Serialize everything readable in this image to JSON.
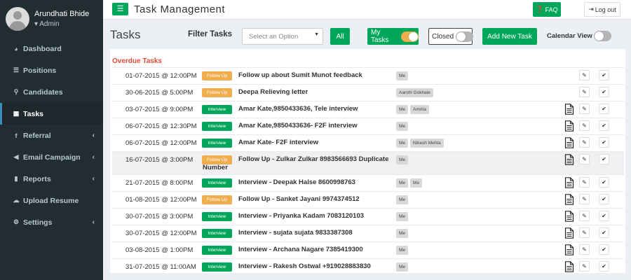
{
  "sidebar": {
    "user_name": "Arundhati Bhide",
    "user_role": "▾ Admin",
    "items": [
      {
        "label": "Dashboard",
        "icon": "dashboard-icon",
        "glyph": "◕",
        "has_submenu": false,
        "active": false
      },
      {
        "label": "Positions",
        "icon": "list-icon",
        "glyph": "☰",
        "has_submenu": false,
        "active": false
      },
      {
        "label": "Candidates",
        "icon": "search-icon",
        "glyph": "⚲",
        "has_submenu": false,
        "active": false
      },
      {
        "label": "Tasks",
        "icon": "calendar-icon",
        "glyph": "▦",
        "has_submenu": false,
        "active": true
      },
      {
        "label": "Referral",
        "icon": "facebook-icon",
        "glyph": "f",
        "has_submenu": true,
        "active": false
      },
      {
        "label": "Email Campaign",
        "icon": "bullhorn-icon",
        "glyph": "◀",
        "has_submenu": true,
        "active": false
      },
      {
        "label": "Reports",
        "icon": "bar-chart-icon",
        "glyph": "▮",
        "has_submenu": true,
        "active": false
      },
      {
        "label": "Upload Resume",
        "icon": "cloud-upload-icon",
        "glyph": "☁",
        "has_submenu": false,
        "active": false
      },
      {
        "label": "Settings",
        "icon": "gear-icon",
        "glyph": "⚙",
        "has_submenu": true,
        "active": false
      }
    ]
  },
  "topbar": {
    "title": "Task Management",
    "faq_label": "FAQ",
    "logout_label": "Log out"
  },
  "toolbar": {
    "page_title": "Tasks",
    "filter_label": "Filter Tasks",
    "filter_placeholder": "Select an Option",
    "all_label": "All",
    "my_tasks_label": "My Tasks",
    "my_tasks_on": true,
    "closed_label": "Closed",
    "closed_on": false,
    "add_task_label": "Add New Task",
    "calendar_label": "Calendar View",
    "calendar_on": false
  },
  "section_title": "Overdue Tasks",
  "colors": {
    "accent_green": "#00a65a",
    "follow_up_orange": "#f0ad4e",
    "overdue_red": "#dd4b39",
    "sidebar_bg": "#222d32"
  },
  "tasks": [
    {
      "datetime": "01-07-2015 @ 12:00PM",
      "type": "Follow Up",
      "title": "Follow up about Sumit Munot feedback",
      "assignees": [
        "Me"
      ],
      "has_doc": false
    },
    {
      "datetime": "30-06-2015 @ 5:00PM",
      "type": "Follow Up",
      "title": "Deepa Relieving letter",
      "assignees": [
        "Aarohi Gokhale"
      ],
      "has_doc": false
    },
    {
      "datetime": "03-07-2015 @ 9:00PM",
      "type": "Interview",
      "title": "Amar Kate,9850433636, Tele interview",
      "assignees": [
        "Me",
        "Amrita"
      ],
      "has_doc": true
    },
    {
      "datetime": "06-07-2015 @ 12:30PM",
      "type": "Interview",
      "title": "Amar Kate,9850433636- F2F interview",
      "assignees": [
        "Me"
      ],
      "has_doc": true
    },
    {
      "datetime": "06-07-2015 @ 12:00PM",
      "type": "Interview",
      "title": "Amar Kate- F2F interview",
      "assignees": [
        "Me",
        "Nikesh Mehta"
      ],
      "has_doc": true
    },
    {
      "datetime": "16-07-2015 @ 3:00PM",
      "type": "Follow Up",
      "title": "Follow Up - Zulkar Zulkar 8983566693 Duplicate Number",
      "assignees": [
        "Me"
      ],
      "has_doc": true
    },
    {
      "datetime": "21-07-2015 @ 8:00PM",
      "type": "Interview",
      "title": "Interview - Deepak Halse 8600998763",
      "assignees": [
        "Me",
        "Me"
      ],
      "has_doc": true
    },
    {
      "datetime": "01-08-2015 @ 12:00PM",
      "type": "Follow Up",
      "title": "Follow Up - Sanket Jayani 9974374512",
      "assignees": [
        "Me"
      ],
      "has_doc": true
    },
    {
      "datetime": "30-07-2015 @ 3:00PM",
      "type": "Interview",
      "title": "Interview - Priyanka Kadam 7083120103",
      "assignees": [
        "Me"
      ],
      "has_doc": true
    },
    {
      "datetime": "30-07-2015 @ 12:00PM",
      "type": "Interview",
      "title": "Interview - sujata sujata 9833387308",
      "assignees": [
        "Me"
      ],
      "has_doc": true
    },
    {
      "datetime": "03-08-2015 @ 1:00PM",
      "type": "Interview",
      "title": "Interview - Archana Nagare 7385419300",
      "assignees": [
        "Me"
      ],
      "has_doc": true
    },
    {
      "datetime": "31-07-2015 @ 11:00AM",
      "type": "Interview",
      "title": "Interview - Rakesh Ostwal +919028883830",
      "assignees": [
        "Me"
      ],
      "has_doc": true
    }
  ]
}
